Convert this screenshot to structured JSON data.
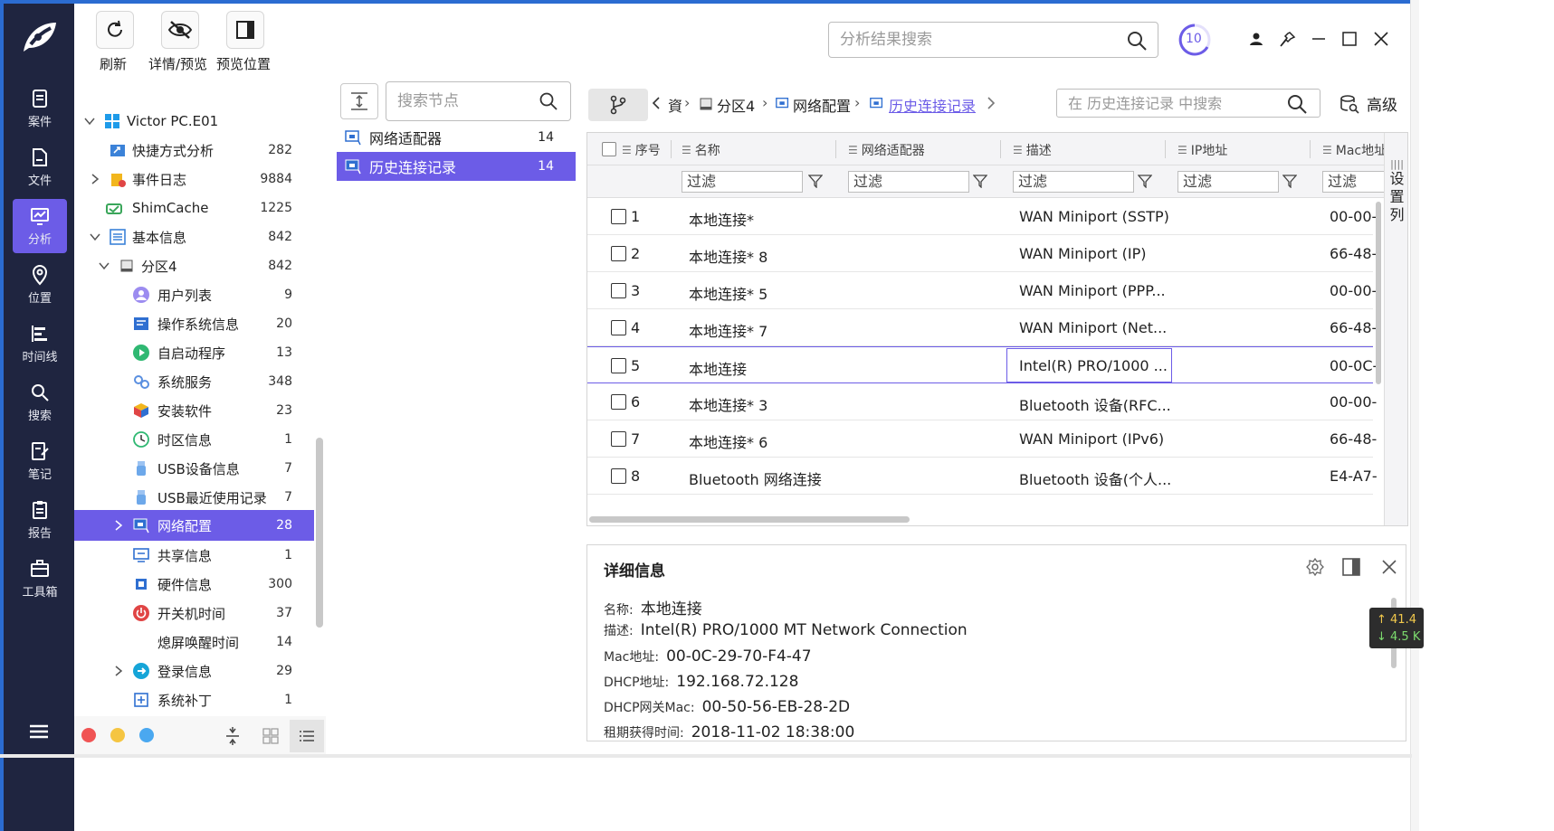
{
  "toolbar": {
    "refresh_label": "刷新",
    "details_label": "详情/预览",
    "preview_pos_label": "预览位置",
    "search_placeholder": "分析结果搜索",
    "progress_value": "10"
  },
  "nav": {
    "items": [
      {
        "label": "案件",
        "icon": "case-icon"
      },
      {
        "label": "文件",
        "icon": "file-icon"
      },
      {
        "label": "分析",
        "icon": "analysis-icon"
      },
      {
        "label": "位置",
        "icon": "location-icon"
      },
      {
        "label": "时间线",
        "icon": "timeline-icon"
      },
      {
        "label": "搜索",
        "icon": "search-icon"
      },
      {
        "label": "笔记",
        "icon": "note-icon"
      },
      {
        "label": "报告",
        "icon": "report-icon"
      },
      {
        "label": "工具箱",
        "icon": "toolbox-icon"
      }
    ],
    "active_index": 2
  },
  "tree": {
    "items": [
      {
        "label": "Victor PC.E01",
        "count": ""
      },
      {
        "label": "快捷方式分析",
        "count": "282"
      },
      {
        "label": "事件日志",
        "count": "9884"
      },
      {
        "label": "ShimCache",
        "count": "1225"
      },
      {
        "label": "基本信息",
        "count": "842"
      },
      {
        "label": "分区4",
        "count": "842"
      },
      {
        "label": "用户列表",
        "count": "9"
      },
      {
        "label": "操作系统信息",
        "count": "20"
      },
      {
        "label": "自启动程序",
        "count": "13"
      },
      {
        "label": "系统服务",
        "count": "348"
      },
      {
        "label": "安装软件",
        "count": "23"
      },
      {
        "label": "时区信息",
        "count": "1"
      },
      {
        "label": "USB设备信息",
        "count": "7"
      },
      {
        "label": "USB最近使用记录",
        "count": "7"
      },
      {
        "label": "网络配置",
        "count": "28"
      },
      {
        "label": "共享信息",
        "count": "1"
      },
      {
        "label": "硬件信息",
        "count": "300"
      },
      {
        "label": "开关机时间",
        "count": "37"
      },
      {
        "label": "熄屏唤醒时间",
        "count": "14"
      },
      {
        "label": "登录信息",
        "count": "29"
      },
      {
        "label": "系统补丁",
        "count": "1"
      }
    ],
    "selected_index": 14
  },
  "nodes": {
    "search_placeholder": "搜索节点",
    "items": [
      {
        "label": "网络适配器",
        "count": "14"
      },
      {
        "label": "历史连接记录",
        "count": "14"
      }
    ],
    "selected_index": 1
  },
  "breadcrumb": {
    "items": [
      "資",
      "分区4",
      "网络配置",
      "历史连接记录"
    ],
    "search_placeholder": "在 历史连接记录 中搜索",
    "advanced_label": "高级"
  },
  "table": {
    "columns": [
      "序号",
      "名称",
      "网络适配器",
      "描述",
      "IP地址",
      "Mac地址"
    ],
    "filter_placeholder": "过滤",
    "set_columns_label": [
      "设",
      "置",
      "列"
    ],
    "rows": [
      {
        "no": "1",
        "name": "本地连接*",
        "adapter": "",
        "desc": "WAN Miniport (SSTP)",
        "ip": "",
        "mac": "00-00-"
      },
      {
        "no": "2",
        "name": "本地连接* 8",
        "adapter": "",
        "desc": "WAN Miniport (IP)",
        "ip": "",
        "mac": "66-48-"
      },
      {
        "no": "3",
        "name": "本地连接* 5",
        "adapter": "",
        "desc": "WAN Miniport (PPP...",
        "ip": "",
        "mac": "00-00-"
      },
      {
        "no": "4",
        "name": "本地连接* 7",
        "adapter": "",
        "desc": "WAN Miniport (Net...",
        "ip": "",
        "mac": "66-48-"
      },
      {
        "no": "5",
        "name": "本地连接",
        "adapter": "",
        "desc": "Intel(R) PRO/1000 ...",
        "ip": "",
        "mac": "00-0C-"
      },
      {
        "no": "6",
        "name": "本地连接* 3",
        "adapter": "",
        "desc": "Bluetooth 设备(RFC...",
        "ip": "",
        "mac": "00-00-"
      },
      {
        "no": "7",
        "name": "本地连接* 6",
        "adapter": "",
        "desc": "WAN Miniport (IPv6)",
        "ip": "",
        "mac": "66-48-"
      },
      {
        "no": "8",
        "name": "Bluetooth 网络连接",
        "adapter": "",
        "desc": "Bluetooth 设备(个人...",
        "ip": "",
        "mac": "E4-A7-"
      }
    ],
    "selected_row": 4
  },
  "detail": {
    "title": "详细信息",
    "fields": [
      {
        "key": "名称:",
        "value": "本地连接"
      },
      {
        "key": "描述:",
        "value": "Intel(R) PRO/1000 MT Network Connection"
      },
      {
        "key": "Mac地址:",
        "value": "00-0C-29-70-F4-47"
      },
      {
        "key": "DHCP地址:",
        "value": "192.168.72.128"
      },
      {
        "key": "DHCP网关Mac:",
        "value": "00-50-56-EB-28-2D"
      },
      {
        "key": "租期获得时间:",
        "value": "2018-11-02 18:38:00"
      }
    ]
  },
  "net_speed": {
    "up": "↑ 41.4",
    "down": "↓ 4.5 K"
  },
  "colors": {
    "accent": "#6c5ce7",
    "nav_bg": "#1f2540"
  }
}
